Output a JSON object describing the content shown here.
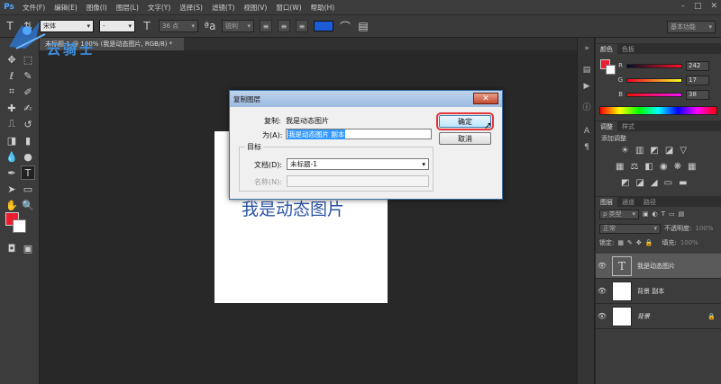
{
  "app": {
    "logo": "Ps"
  },
  "menu": [
    "文件(F)",
    "编辑(E)",
    "图像(I)",
    "图层(L)",
    "文字(Y)",
    "选择(S)",
    "滤镜(T)",
    "视图(V)",
    "窗口(W)",
    "帮助(H)"
  ],
  "options": {
    "font_family": "宋体",
    "font_style": "-",
    "font_size": "36 点",
    "antialias": "锐利",
    "workspace": "基本功能",
    "text_color": "#1d5cd8"
  },
  "document": {
    "tab_title": "未标题-1 @ 100% (我是动态图片, RGB/8) *"
  },
  "canvas": {
    "text": "我是动态图片"
  },
  "dialog": {
    "title": "复制图层",
    "copy_label": "复制:",
    "copy_value": "我是动态图片",
    "as_label": "为(A):",
    "as_value": "我是动态图片 副本",
    "target_label": "目标",
    "doc_label": "文档(D):",
    "doc_value": "未标题-1",
    "name_label": "名称(N):",
    "ok_label": "确定",
    "cancel_label": "取消"
  },
  "colors": {
    "foreground": "#ee1c2f",
    "background": "#ffffff",
    "accent": "#3399ff"
  },
  "color_panel": {
    "tabs": [
      "颜色",
      "色板"
    ],
    "r_label": "R",
    "r_value": "242",
    "g_label": "G",
    "g_value": "17",
    "b_label": "B",
    "b_value": "38"
  },
  "adjust_panel": {
    "tabs": [
      "调整",
      "样式"
    ],
    "heading": "添加调整"
  },
  "layers_panel": {
    "tabs": [
      "图层",
      "通道",
      "路径"
    ],
    "filter": "ρ 类型",
    "blend_mode": "正常",
    "opacity_label": "不透明度:",
    "opacity_value": "100%",
    "lock_label": "锁定:",
    "fill_label": "填充:",
    "fill_value": "100%",
    "layers": [
      {
        "name": "我是动态图片",
        "type": "text"
      },
      {
        "name": "背景 副本",
        "type": "pixel"
      },
      {
        "name": "背景",
        "type": "pixel"
      }
    ]
  },
  "watermark": {
    "text": "云骑士"
  }
}
